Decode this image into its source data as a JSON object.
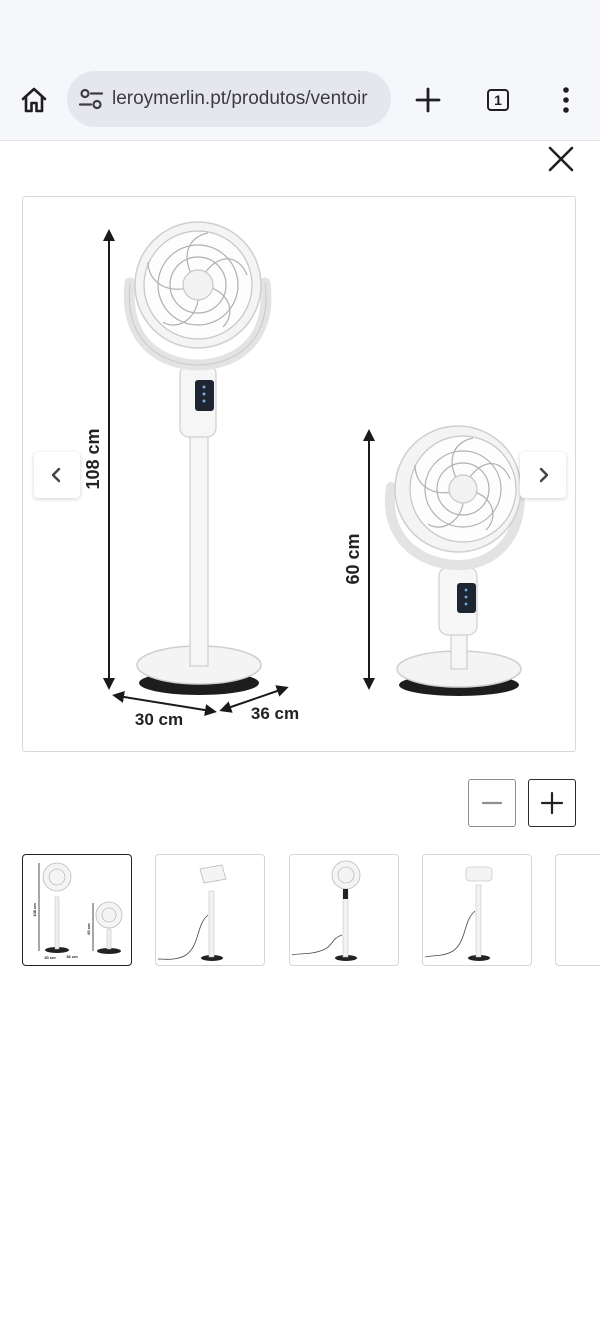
{
  "browser": {
    "url": "leroymerlin.pt/produtos/ventoir",
    "tab_count": "1",
    "icons": {
      "home": "home-icon",
      "site_settings": "site-settings-icon",
      "new_tab": "plus-icon",
      "tabs": "tab-switcher-icon",
      "menu": "more-vertical-icon"
    }
  },
  "gallery": {
    "close_icon": "close-icon",
    "main_image": {
      "description_icon": "fan-product-image",
      "dimensions": {
        "height_tall": "108 cm",
        "height_short": "60 cm",
        "base_depth": "30 cm",
        "base_width": "36 cm"
      }
    },
    "prev_icon": "chevron-left-icon",
    "next_icon": "chevron-right-icon",
    "zoom_out_icon": "minus-icon",
    "zoom_in_icon": "plus-icon",
    "thumbnails": [
      {
        "id": "thumb-1",
        "active": true
      },
      {
        "id": "thumb-2",
        "active": false
      },
      {
        "id": "thumb-3",
        "active": false
      },
      {
        "id": "thumb-4",
        "active": false
      },
      {
        "id": "thumb-5",
        "active": false
      }
    ],
    "thumb_labels": {
      "h1": "108 cm",
      "h2": "60 cm",
      "w1": "30 cm",
      "w2": "36 cm"
    }
  }
}
